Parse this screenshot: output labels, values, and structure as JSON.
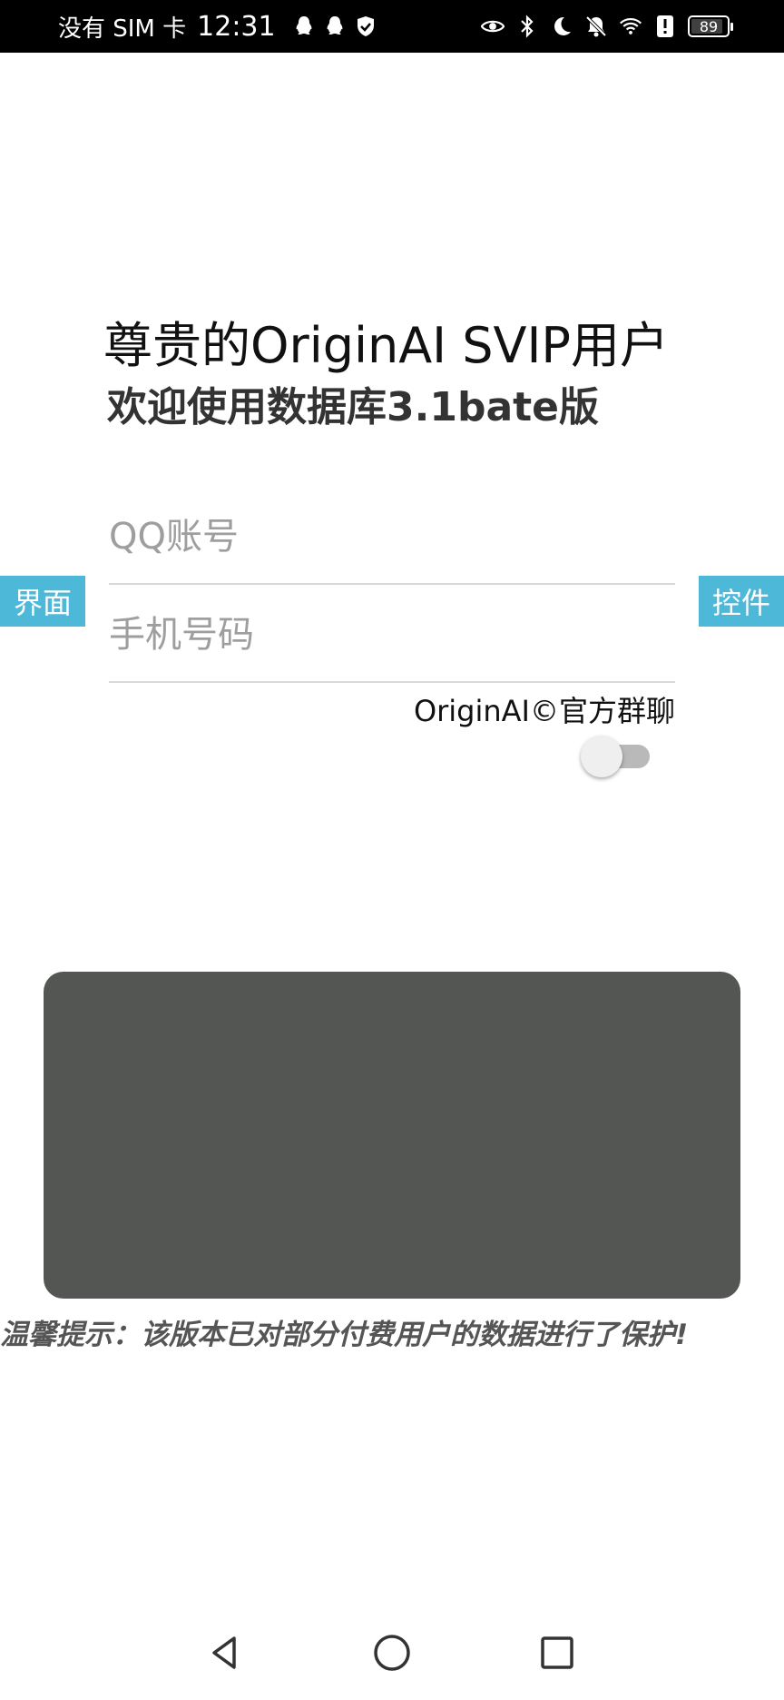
{
  "status_bar": {
    "carrier": "没有 SIM 卡",
    "time": "12:31",
    "left_icons": [
      "qq-icon",
      "qq-icon",
      "shield-check-icon"
    ],
    "right_icons": [
      "eye-icon",
      "bluetooth-icon",
      "moon-icon",
      "bell-off-icon",
      "wifi-icon",
      "alert-icon"
    ],
    "battery": "89"
  },
  "header": {
    "title": "尊贵的OriginAI SVIP用户",
    "subtitle": "欢迎使用数据库3.1bate版"
  },
  "form": {
    "qq_placeholder": "QQ账号",
    "qq_value": "",
    "phone_placeholder": "手机号码",
    "phone_value": ""
  },
  "side_tabs": {
    "left": "界面",
    "right": "控件"
  },
  "group_label": "OriginAI©官方群聊",
  "toggle": {
    "on": false
  },
  "tip": "温馨提示：该版本已对部分付费用户的数据进行了保护!",
  "colors": {
    "tab_bg": "#4db8d8",
    "panel_bg": "#545654",
    "status_bar_bg": "#000000"
  },
  "nav": [
    "back-icon",
    "home-icon",
    "recent-apps-icon"
  ]
}
